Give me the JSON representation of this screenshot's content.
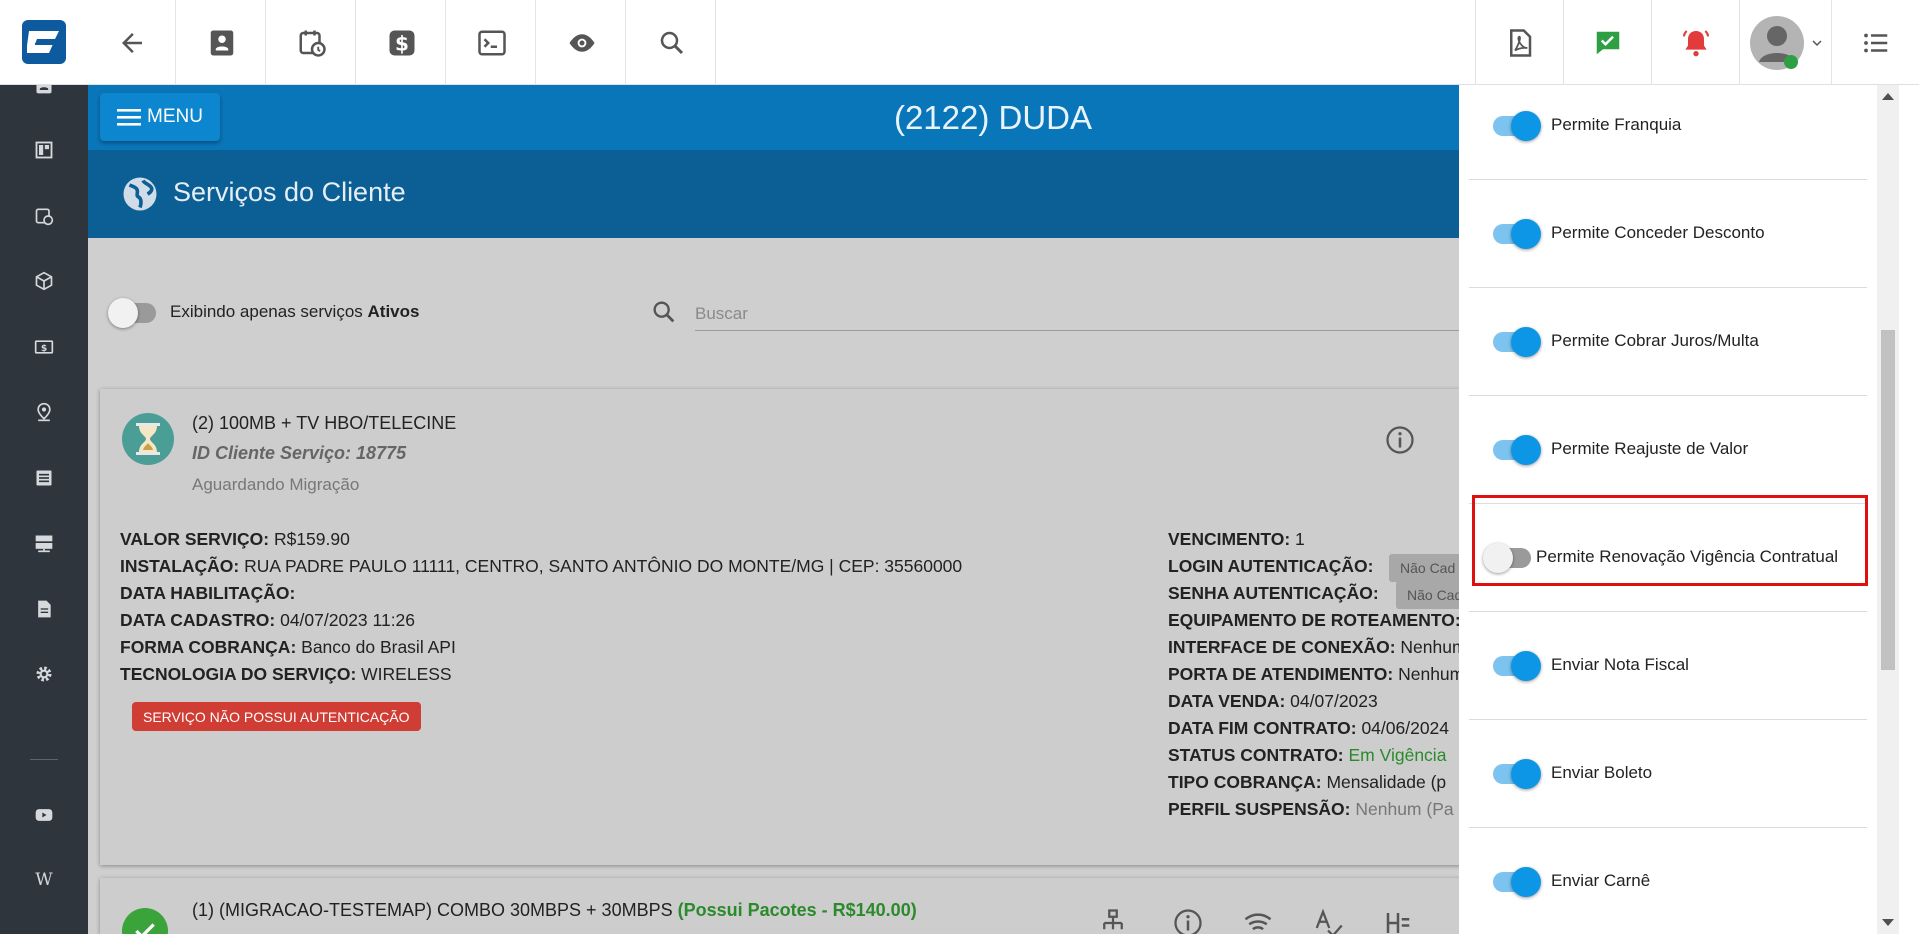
{
  "topbar": {
    "icons": [
      "back-arrow-icon",
      "contact-card-icon",
      "calendar-clock-icon",
      "dollar-icon",
      "terminal-icon",
      "eye-icon",
      "search-icon"
    ],
    "right_icons": [
      "pdf-icon",
      "chat-check-icon",
      "bell-alert-icon",
      "user-avatar",
      "list-icon"
    ],
    "colors": {
      "chat": "#2ea043",
      "bell": "#e23b3b"
    }
  },
  "sidebar": {
    "icons": [
      "contact-card-icon",
      "dashboard-icon",
      "calendar-clock-icon",
      "box-icon",
      "dollar-bill-icon",
      "location-user-icon",
      "list-doc-icon",
      "server-icon",
      "document-icon",
      "gear-icon",
      "youtube-icon",
      "wiki-icon"
    ],
    "wiki_glyph": "W"
  },
  "header": {
    "menu_label": "MENU",
    "client_title": "(2122) DUDA",
    "section_title": "Serviços do Cliente"
  },
  "filter": {
    "label_prefix": "Exibindo apenas serviços ",
    "label_bold": "Ativos",
    "search_placeholder": "Buscar"
  },
  "service1": {
    "title": "(2) 100MB + TV HBO/TELECINE",
    "id_label": "ID Cliente Serviço: 18775",
    "status": "Aguardando Migração",
    "left_fields": [
      {
        "label": "VALOR SERVIÇO:",
        "value": " R$159.90"
      },
      {
        "label": "INSTALAÇÃO:",
        "value": " RUA PADRE PAULO 11111, CENTRO, SANTO ANTÔNIO DO MONTE/MG | CEP: 35560000"
      },
      {
        "label": "DATA HABILITAÇÃO:",
        "value": ""
      },
      {
        "label": "DATA CADASTRO:",
        "value": " 04/07/2023 11:26"
      },
      {
        "label": "FORMA COBRANÇA:",
        "value": " Banco do Brasil API"
      },
      {
        "label": "TECNOLOGIA DO SERVIÇO:",
        "value": " WIRELESS"
      }
    ],
    "right_fields": [
      {
        "label": "VENCIMENTO:",
        "value": " 1"
      },
      {
        "label": "LOGIN AUTENTICAÇÃO:",
        "value": ""
      },
      {
        "label": "SENHA AUTENTICAÇÃO:",
        "value": ""
      },
      {
        "label": "EQUIPAMENTO DE ROTEAMENTO:",
        "value": ""
      },
      {
        "label": "INTERFACE DE CONEXÃO:",
        "value": " Nenhum"
      },
      {
        "label": "PORTA DE ATENDIMENTO:",
        "value": " Nenhum"
      },
      {
        "label": "DATA VENDA:",
        "value": " 04/07/2023"
      },
      {
        "label": "DATA FIM CONTRATO:",
        "value": " 04/06/2024"
      },
      {
        "label": "STATUS CONTRATO:",
        "value": " Em Vigência"
      },
      {
        "label": "TIPO COBRANÇA:",
        "value": " Mensalidade (p"
      },
      {
        "label": "PERFIL SUSPENSÃO:",
        "value": " Nenhum (Pa"
      }
    ],
    "login_badge": "Não Cad",
    "senha_badge": "Não Cad",
    "auth_warning": "SERVIÇO NÃO POSSUI AUTENTICAÇÃO"
  },
  "service2": {
    "title": "(1) (MIGRACAO-TESTEMAP) COMBO 30MBPS + 30MBPS ",
    "packages": "(Possui Pacotes - R$140.00)",
    "icons": [
      "network-icon",
      "info-icon",
      "wifi-icon",
      "spellcheck-icon",
      "heading-icon"
    ]
  },
  "permissions": [
    {
      "label": "Permite Franquia",
      "enabled": true
    },
    {
      "label": "Permite Conceder Desconto",
      "enabled": true
    },
    {
      "label": "Permite Cobrar Juros/Multa",
      "enabled": true
    },
    {
      "label": "Permite Reajuste de Valor",
      "enabled": true
    },
    {
      "label": "Permite Renovação Vigência Contratual",
      "enabled": false
    },
    {
      "label": "Enviar Nota Fiscal",
      "enabled": true
    },
    {
      "label": "Enviar Boleto",
      "enabled": true
    },
    {
      "label": "Enviar Carnê",
      "enabled": true
    }
  ]
}
